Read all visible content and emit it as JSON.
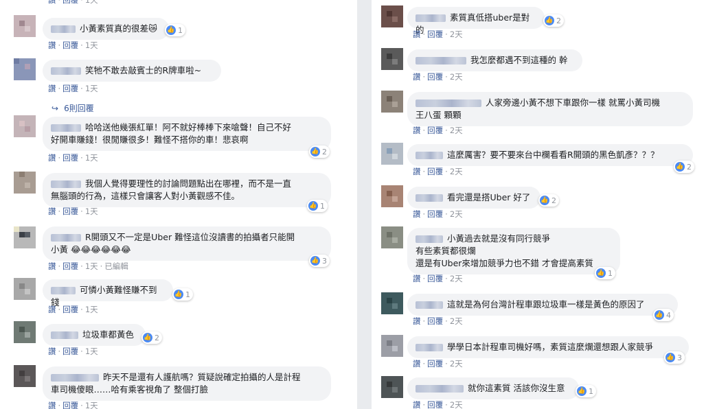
{
  "left": {
    "top_partial": {
      "like": "讚",
      "reply": "回覆",
      "time": "1天"
    },
    "comments": [
      {
        "text": "小黃素質真的很差😿",
        "likes": "1",
        "like": "讚",
        "reply": "回覆",
        "time": "1天"
      },
      {
        "text": "笑牠不敢去敲賓士的R牌車啦~",
        "likes": "",
        "like": "讚",
        "reply": "回覆",
        "time": "1天",
        "replies": "6則回覆"
      },
      {
        "text": "哈哈送他幾張紅單！阿不就好棒棒下來嗆聲！自己不好\n好開車賺錢！很閒賺很多！難怪不搭你的車！悲哀啊",
        "likes": "2",
        "like": "讚",
        "reply": "回覆",
        "time": "1天"
      },
      {
        "text": "我個人覺得要理性的討論問題點出在哪裡，而不是一直\n無腦頭的行為，這樣只會讓客人對小黃觀感不佳。",
        "likes": "1",
        "like": "讚",
        "reply": "回覆",
        "time": "1天"
      },
      {
        "text": "R開頭又不一定是Uber 難怪這位沒讀書的拍攝者只能開\n小黃 😂😂😂😂😂😂",
        "likes": "3",
        "like": "讚",
        "reply": "回覆",
        "time": "1天",
        "edited": "已編輯"
      },
      {
        "text": "可憐小黃難怪賺不到錢",
        "likes": "1",
        "like": "讚",
        "reply": "回覆",
        "time": "1天"
      },
      {
        "text": "垃圾車都黃色",
        "likes": "2",
        "like": "讚",
        "reply": "回覆",
        "time": "1天"
      },
      {
        "text": "昨天不是還有人護航嗎？質疑說確定拍攝的人是計程\n車司機傻眼……哈有乘客視角了 整個打臉",
        "likes": "",
        "like": "讚",
        "reply": "回覆",
        "time": "1天"
      }
    ]
  },
  "right": {
    "comments": [
      {
        "text": "素質真低搭uber是對的",
        "likes": "2",
        "like": "讚",
        "reply": "回覆",
        "time": "2天"
      },
      {
        "text": "我怎麼都遇不到這種的 幹",
        "likes": "",
        "like": "讚",
        "reply": "回覆",
        "time": "2天"
      },
      {
        "text": "人家旁邊小黃不想下車跟你一樣 就罵小黃司機\n王八蛋 顆顆",
        "likes": "",
        "like": "讚",
        "reply": "回覆",
        "time": "2天"
      },
      {
        "text": "這麼厲害？要不要來台中欄看看R開頭的黑色凱彥？？？",
        "likes": "2",
        "like": "讚",
        "reply": "回覆",
        "time": "2天"
      },
      {
        "text": "看完還是搭Uber 好了",
        "likes": "2",
        "like": "讚",
        "reply": "回覆",
        "time": "2天"
      },
      {
        "text": "小黃過去就是沒有同行競爭\n有些素質都很爛\n還是有Uber來增加競爭力也不錯 才會提高素質",
        "likes": "1",
        "like": "讚",
        "reply": "回覆",
        "time": "2天"
      },
      {
        "text": "這就是為何台灣計程車跟垃圾車一樣是黃色的原因了",
        "likes": "4",
        "like": "讚",
        "reply": "回覆",
        "time": "2天"
      },
      {
        "text": "學學日本計程車司機好嗎，素質這麼爛還想跟人家競爭",
        "likes": "3",
        "like": "讚",
        "reply": "回覆",
        "time": "2天"
      },
      {
        "text": "就你這素質 活該你沒生意",
        "likes": "1",
        "like": "讚",
        "reply": "回覆",
        "time": "2天"
      }
    ]
  }
}
